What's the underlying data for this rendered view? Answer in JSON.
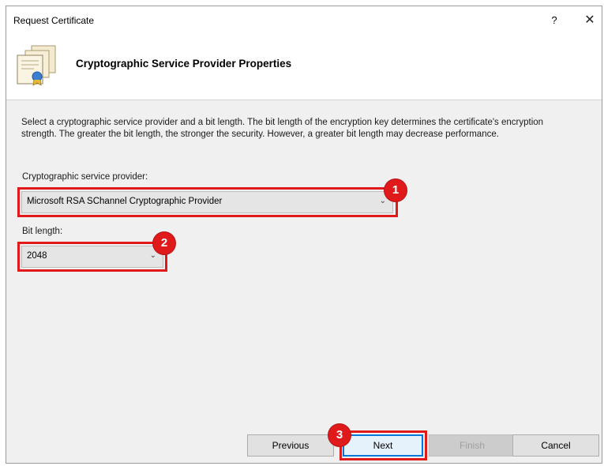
{
  "window": {
    "title": "Request Certificate",
    "help_label": "?",
    "close_label": "✕"
  },
  "header": {
    "title": "Cryptographic Service Provider Properties",
    "icon": "certificate-icon"
  },
  "body": {
    "description": "Select a cryptographic service provider and a bit length. The bit length of the encryption key determines the certificate's encryption strength. The greater the bit length, the stronger the security. However, a greater bit length may decrease performance.",
    "csp_label": "Cryptographic service provider:",
    "csp_value": "Microsoft RSA SChannel Cryptographic Provider",
    "bit_label": "Bit length:",
    "bit_value": "2048"
  },
  "buttons": {
    "previous": "Previous",
    "next": "Next",
    "finish": "Finish",
    "cancel": "Cancel"
  },
  "annotations": {
    "step1": "1",
    "step2": "2",
    "step3": "3",
    "color": "#e0191b"
  }
}
